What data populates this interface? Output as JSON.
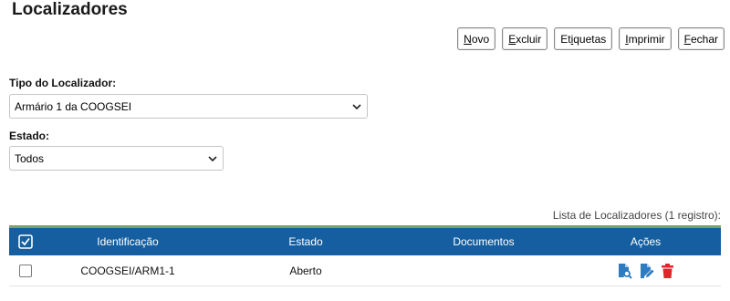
{
  "page": {
    "title": "Localizadores"
  },
  "toolbar": {
    "novo_label": "Novo",
    "novo_key": "N",
    "novo_rest": "ovo",
    "excluir_key": "E",
    "excluir_rest": "xcluir",
    "etiquetas_pre": "Et",
    "etiquetas_key": "i",
    "etiquetas_post": "quetas",
    "imprimir_key": "I",
    "imprimir_rest": "mprimir",
    "fechar_key": "F",
    "fechar_rest": "echar"
  },
  "filters": {
    "tipo_label": "Tipo do Localizador:",
    "tipo_value": "Armário 1 da COOGSEI",
    "estado_label": "Estado:",
    "estado_value": "Todos"
  },
  "table": {
    "caption": "Lista de Localizadores (1 registro):",
    "headers": [
      "Identificação",
      "Estado",
      "Documentos",
      "Ações"
    ],
    "rows": [
      {
        "identificacao": "COOGSEI/ARM1-1",
        "estado": "Aberto",
        "documentos": ""
      }
    ]
  },
  "colors": {
    "header_bg": "#155fa0",
    "header_top_border": "#7ea06a",
    "action_icon_blue": "#2f7bbf",
    "delete_icon_red": "#e0262b"
  },
  "icons": {
    "select_all": "checkbox-checked-icon",
    "view": "document-search-icon",
    "edit": "document-edit-icon",
    "delete": "trash-icon"
  }
}
